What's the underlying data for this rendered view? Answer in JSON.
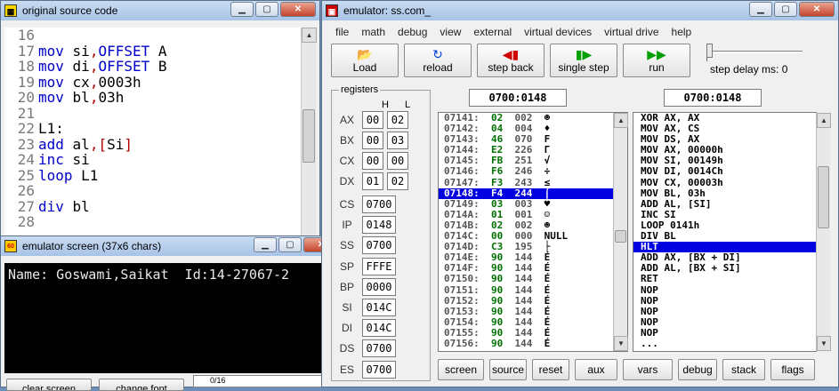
{
  "source_window": {
    "title": "original source code",
    "lines": [
      {
        "n": "16",
        "parts": []
      },
      {
        "n": "17",
        "parts": [
          [
            "kw",
            "mov"
          ],
          [
            "reg",
            " si"
          ],
          [
            "punct",
            ","
          ],
          [
            "kw",
            "OFFSET"
          ],
          [
            "reg",
            " A"
          ]
        ]
      },
      {
        "n": "18",
        "parts": [
          [
            "kw",
            "mov"
          ],
          [
            "reg",
            " di"
          ],
          [
            "punct",
            ","
          ],
          [
            "kw",
            "OFFSET"
          ],
          [
            "reg",
            " B"
          ]
        ]
      },
      {
        "n": "19",
        "parts": [
          [
            "kw",
            "mov"
          ],
          [
            "reg",
            " cx"
          ],
          [
            "punct",
            ","
          ],
          [
            "num",
            "0003h"
          ]
        ]
      },
      {
        "n": "20",
        "parts": [
          [
            "kw",
            "mov"
          ],
          [
            "reg",
            " bl"
          ],
          [
            "punct",
            ","
          ],
          [
            "num",
            "03h"
          ]
        ]
      },
      {
        "n": "21",
        "parts": []
      },
      {
        "n": "22",
        "parts": [
          [
            "reg",
            "L1:"
          ]
        ]
      },
      {
        "n": "23",
        "parts": [
          [
            "kw",
            "add"
          ],
          [
            "reg",
            " al"
          ],
          [
            "punct",
            ",["
          ],
          [
            "reg",
            "Si"
          ],
          [
            "punct",
            "]"
          ]
        ]
      },
      {
        "n": "24",
        "parts": [
          [
            "kw",
            "inc"
          ],
          [
            "reg",
            " si"
          ]
        ]
      },
      {
        "n": "25",
        "parts": [
          [
            "kw",
            "loop"
          ],
          [
            "reg",
            " L1"
          ]
        ]
      },
      {
        "n": "26",
        "parts": []
      },
      {
        "n": "27",
        "parts": [
          [
            "kw",
            "div"
          ],
          [
            "reg",
            " bl"
          ]
        ]
      },
      {
        "n": "28",
        "parts": []
      }
    ]
  },
  "screen_window": {
    "title": "emulator screen (37x6 chars)",
    "output": "Name: Goswami,Saikat  Id:14-27067-2",
    "clear_label": "clear screen",
    "font_label": "change font",
    "counter": "0/16"
  },
  "emulator": {
    "title": "emulator: ss.com_",
    "menu": [
      "file",
      "math",
      "debug",
      "view",
      "external",
      "virtual devices",
      "virtual drive",
      "help"
    ],
    "toolbar": {
      "load": "Load",
      "reload": "reload",
      "step_back": "step back",
      "single_step": "single step",
      "run": "run",
      "step_delay": "step delay ms: 0"
    },
    "registers_title": "registers",
    "h_label": "H",
    "l_label": "L",
    "gp_registers": [
      {
        "name": "AX",
        "h": "00",
        "l": "02"
      },
      {
        "name": "BX",
        "h": "00",
        "l": "03"
      },
      {
        "name": "CX",
        "h": "00",
        "l": "00"
      },
      {
        "name": "DX",
        "h": "01",
        "l": "02"
      }
    ],
    "seg_registers": [
      {
        "name": "CS",
        "value": "0700"
      },
      {
        "name": "IP",
        "value": "0148"
      },
      {
        "name": "SS",
        "value": "0700"
      },
      {
        "name": "SP",
        "value": "FFFE"
      },
      {
        "name": "BP",
        "value": "0000"
      },
      {
        "name": "SI",
        "value": "014C"
      },
      {
        "name": "DI",
        "value": "014C"
      },
      {
        "name": "DS",
        "value": "0700"
      },
      {
        "name": "ES",
        "value": "0700"
      }
    ],
    "mem_address": "0700:0148",
    "dis_address": "0700:0148",
    "memory": [
      {
        "addr": "07141:",
        "hex": "02",
        "dec": "002",
        "ch": "☻",
        "sel": false
      },
      {
        "addr": "07142:",
        "hex": "04",
        "dec": "004",
        "ch": "♦",
        "sel": false
      },
      {
        "addr": "07143:",
        "hex": "46",
        "dec": "070",
        "ch": "F",
        "sel": false
      },
      {
        "addr": "07144:",
        "hex": "E2",
        "dec": "226",
        "ch": "Γ",
        "sel": false
      },
      {
        "addr": "07145:",
        "hex": "FB",
        "dec": "251",
        "ch": "√",
        "sel": false
      },
      {
        "addr": "07146:",
        "hex": "F6",
        "dec": "246",
        "ch": "÷",
        "sel": false
      },
      {
        "addr": "07147:",
        "hex": "F3",
        "dec": "243",
        "ch": "≤",
        "sel": false
      },
      {
        "addr": "07148:",
        "hex": "F4",
        "dec": "244",
        "ch": "⌠",
        "sel": true
      },
      {
        "addr": "07149:",
        "hex": "03",
        "dec": "003",
        "ch": "♥",
        "sel": false
      },
      {
        "addr": "0714A:",
        "hex": "01",
        "dec": "001",
        "ch": "☺",
        "sel": false
      },
      {
        "addr": "0714B:",
        "hex": "02",
        "dec": "002",
        "ch": "☻",
        "sel": false
      },
      {
        "addr": "0714C:",
        "hex": "00",
        "dec": "000",
        "ch": "NULL",
        "sel": false
      },
      {
        "addr": "0714D:",
        "hex": "C3",
        "dec": "195",
        "ch": "├",
        "sel": false
      },
      {
        "addr": "0714E:",
        "hex": "90",
        "dec": "144",
        "ch": "É",
        "sel": false
      },
      {
        "addr": "0714F:",
        "hex": "90",
        "dec": "144",
        "ch": "É",
        "sel": false
      },
      {
        "addr": "07150:",
        "hex": "90",
        "dec": "144",
        "ch": "É",
        "sel": false
      },
      {
        "addr": "07151:",
        "hex": "90",
        "dec": "144",
        "ch": "É",
        "sel": false
      },
      {
        "addr": "07152:",
        "hex": "90",
        "dec": "144",
        "ch": "É",
        "sel": false
      },
      {
        "addr": "07153:",
        "hex": "90",
        "dec": "144",
        "ch": "É",
        "sel": false
      },
      {
        "addr": "07154:",
        "hex": "90",
        "dec": "144",
        "ch": "É",
        "sel": false
      },
      {
        "addr": "07155:",
        "hex": "90",
        "dec": "144",
        "ch": "É",
        "sel": false
      },
      {
        "addr": "07156:",
        "hex": "90",
        "dec": "144",
        "ch": "É",
        "sel": false
      }
    ],
    "disassembly": [
      {
        "text": "XOR AX, AX",
        "sel": false
      },
      {
        "text": "MOV AX, CS",
        "sel": false
      },
      {
        "text": "MOV DS, AX",
        "sel": false
      },
      {
        "text": "MOV AX, 00000h",
        "sel": false
      },
      {
        "text": "MOV SI, 00149h",
        "sel": false
      },
      {
        "text": "MOV DI, 0014Ch",
        "sel": false
      },
      {
        "text": "MOV CX, 00003h",
        "sel": false
      },
      {
        "text": "MOV BL, 03h",
        "sel": false
      },
      {
        "text": "ADD AL, [SI]",
        "sel": false
      },
      {
        "text": "INC SI",
        "sel": false
      },
      {
        "text": "LOOP 0141h",
        "sel": false
      },
      {
        "text": "DIV BL",
        "sel": false
      },
      {
        "text": "HLT",
        "sel": true
      },
      {
        "text": "ADD AX, [BX + DI]",
        "sel": false
      },
      {
        "text": "ADD AL, [BX + SI]",
        "sel": false
      },
      {
        "text": "RET",
        "sel": false
      },
      {
        "text": "NOP",
        "sel": false
      },
      {
        "text": "NOP",
        "sel": false
      },
      {
        "text": "NOP",
        "sel": false
      },
      {
        "text": "NOP",
        "sel": false
      },
      {
        "text": "NOP",
        "sel": false
      },
      {
        "text": "...",
        "sel": false
      }
    ],
    "bottom_buttons": [
      "screen",
      "source",
      "reset",
      "aux",
      "vars",
      "debug",
      "stack",
      "flags"
    ]
  }
}
